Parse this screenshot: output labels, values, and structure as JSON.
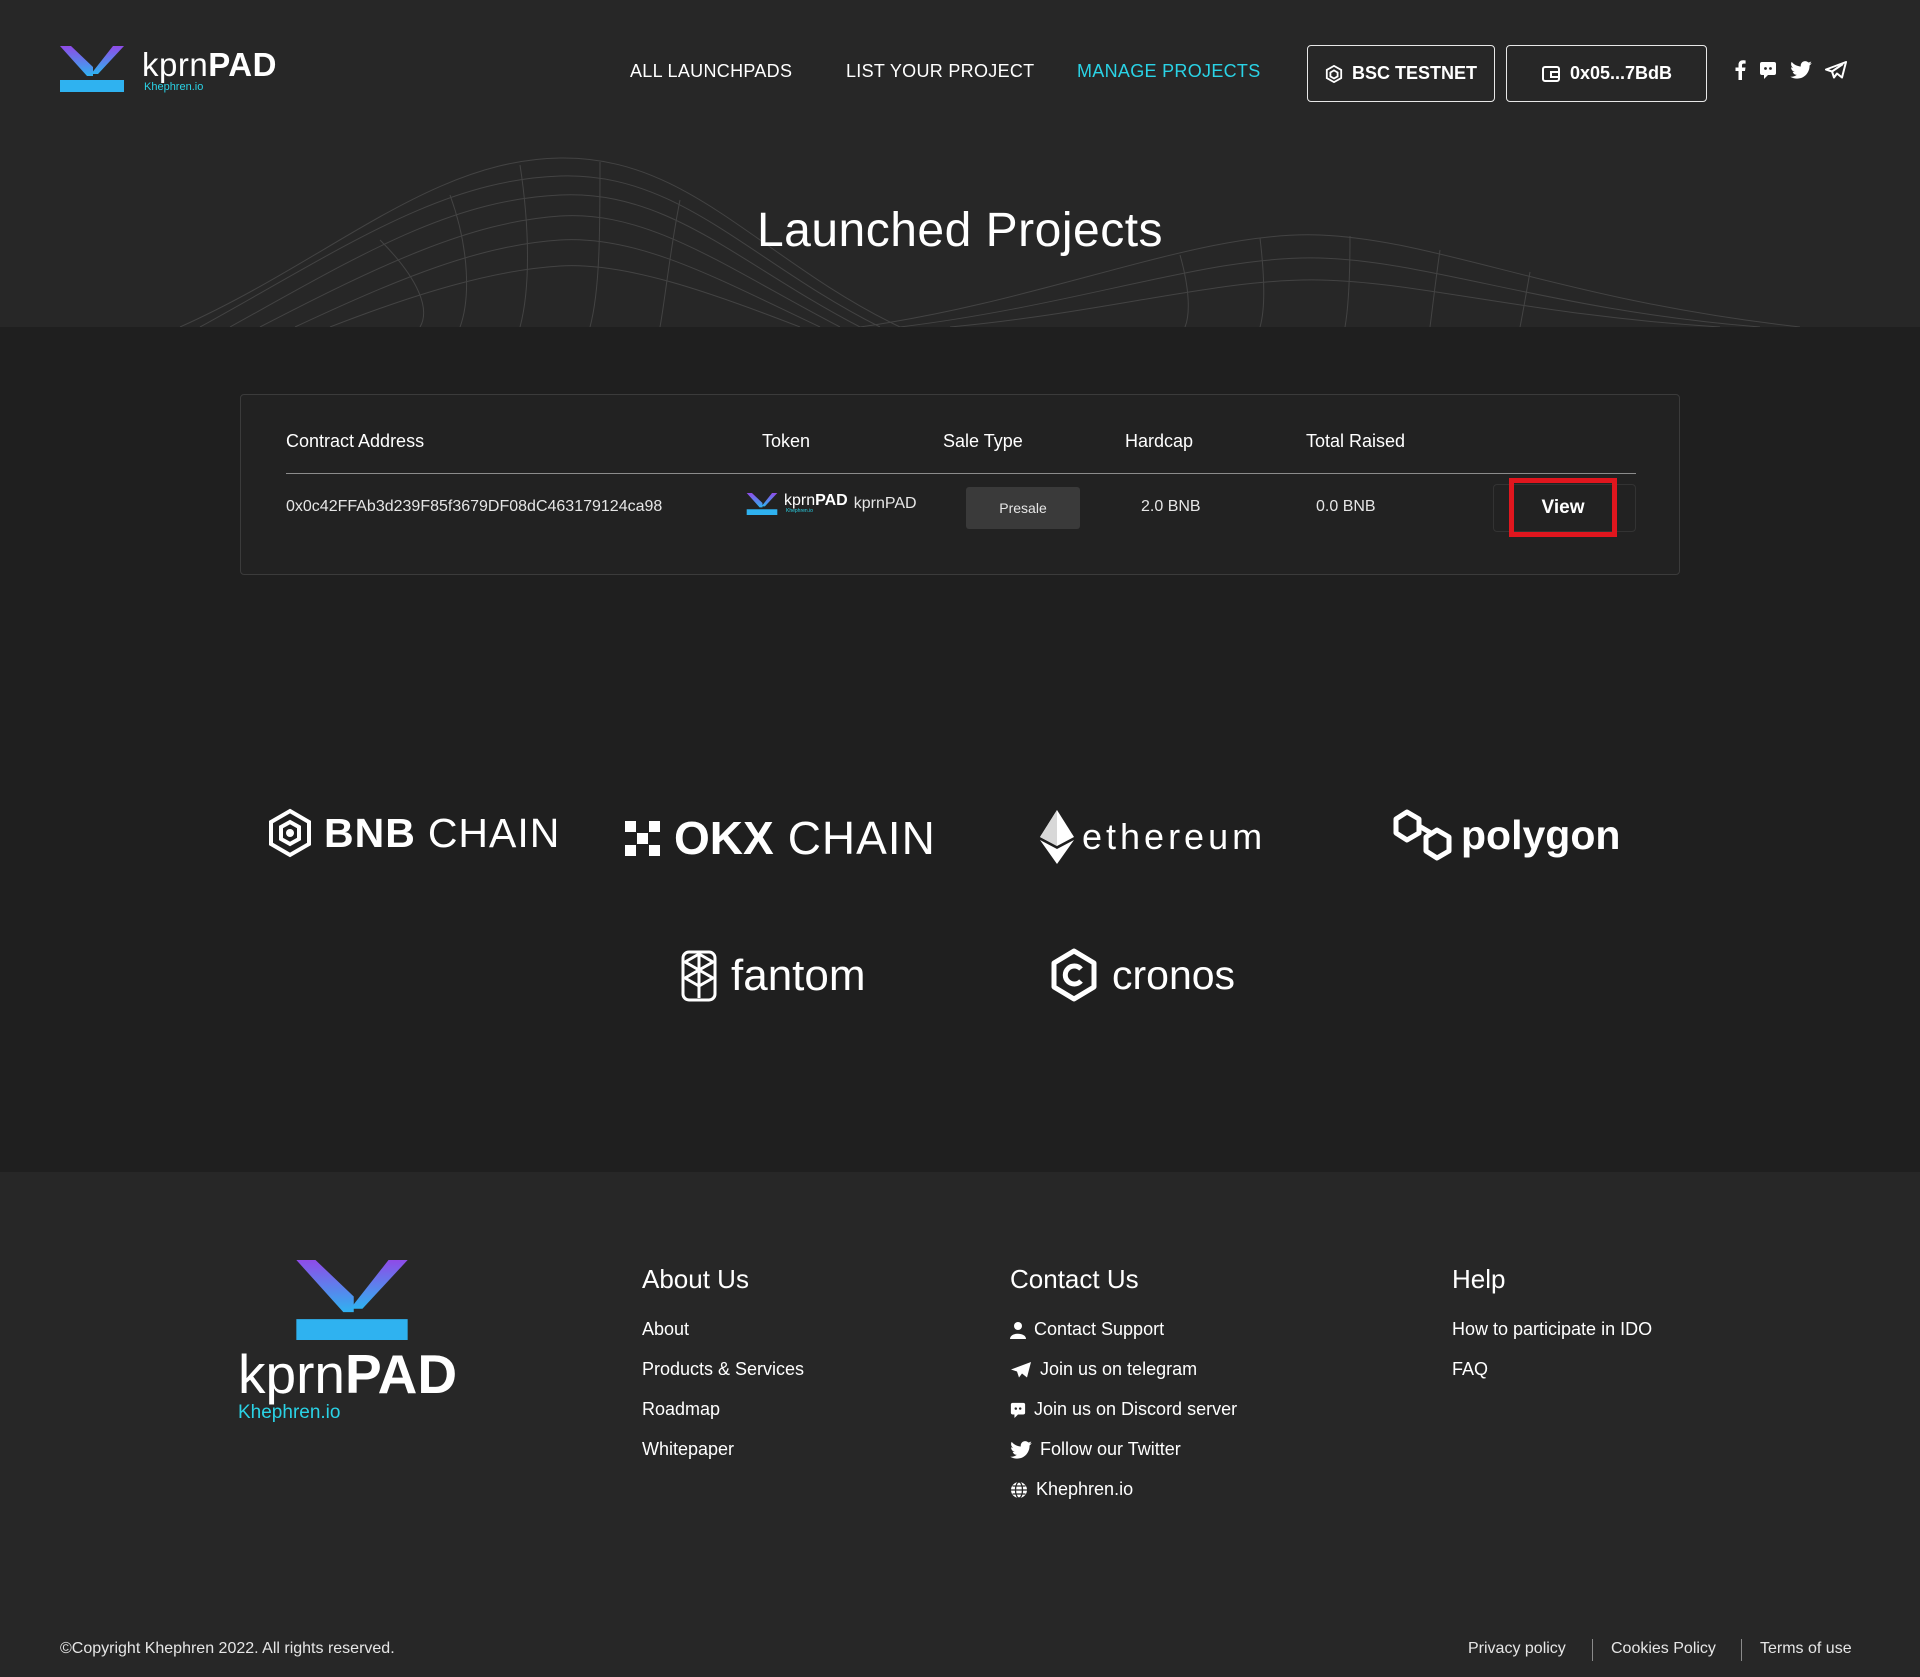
{
  "brand": {
    "name_light": "kprn",
    "name_bold": "PAD",
    "subtitle": "Khephren.io",
    "accent": "#2ad3e6",
    "gradient_top": "#8f4be8",
    "gradient_bottom": "#2fb2f0"
  },
  "nav": {
    "items": [
      {
        "label": "ALL LAUNCHPADS",
        "active": false
      },
      {
        "label": "LIST YOUR PROJECT",
        "active": false
      },
      {
        "label": "MANAGE PROJECTS",
        "active": true
      }
    ],
    "network_label": "BSC TESTNET",
    "wallet_label": "0x05...7BdB",
    "social_icons": [
      "facebook-icon",
      "discord-icon",
      "twitter-icon",
      "telegram-icon"
    ]
  },
  "page_title": "Launched Projects",
  "table": {
    "headers": [
      "Contract Address",
      "Token",
      "Sale Type",
      "Hardcap",
      "Total Raised"
    ],
    "rows": [
      {
        "contract": "0x0c42FFAb3d239F85f3679DF08dC463179124ca98",
        "token_logo_light": "kprn",
        "token_logo_bold": "PAD",
        "token_logo_sub": "Khephren.io",
        "token": "kprnPAD",
        "sale_type": "Presale",
        "hardcap": "2.0 BNB",
        "total_raised": "0.0 BNB",
        "action": "View"
      }
    ],
    "highlight_color": "#e0161e"
  },
  "chains": {
    "bnb_bold": "BNB",
    "bnb_light": "CHAIN",
    "okx_bold": "OKX",
    "okx_light": "CHAIN",
    "ethereum": "ethereum",
    "polygon": "polygon",
    "fantom": "fantom",
    "cronos": "cronos"
  },
  "footer": {
    "about": {
      "title": "About Us",
      "links": [
        "About",
        "Products & Services",
        "Roadmap",
        "Whitepaper"
      ]
    },
    "contact": {
      "title": "Contact Us",
      "links": [
        {
          "label": "Contact Support",
          "icon": "user-icon"
        },
        {
          "label": "Join us on telegram",
          "icon": "telegram-icon"
        },
        {
          "label": "Join us on Discord server",
          "icon": "discord-icon"
        },
        {
          "label": "Follow our Twitter",
          "icon": "twitter-icon"
        },
        {
          "label": "Khephren.io",
          "icon": "globe-icon"
        }
      ]
    },
    "help": {
      "title": "Help",
      "links": [
        "How to participate in IDO",
        "FAQ"
      ]
    },
    "copyright": "©Copyright Khephren 2022. All rights reserved.",
    "legal": [
      "Privacy policy",
      "Cookies Policy",
      "Terms of use"
    ]
  }
}
